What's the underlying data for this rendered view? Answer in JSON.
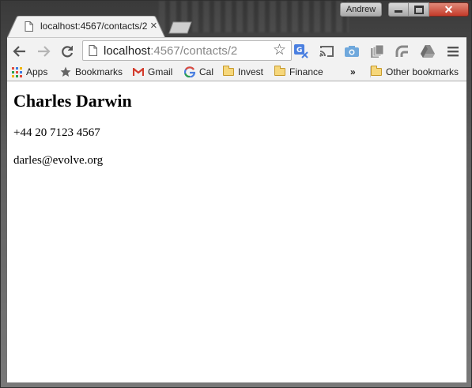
{
  "window": {
    "profile_name": "Andrew",
    "close_glyph": "✕"
  },
  "tab": {
    "title": "localhost:4567/contacts/2",
    "close_glyph": "×"
  },
  "toolbar": {
    "url_host": "localhost",
    "url_path": ":4567/contacts/2",
    "star_glyph": "☆"
  },
  "bookmarks": {
    "items": [
      {
        "label": "Apps",
        "icon": "apps-grid-icon"
      },
      {
        "label": "Bookmarks",
        "icon": "star-icon"
      },
      {
        "label": "Gmail",
        "icon": "gmail-icon"
      },
      {
        "label": "Cal",
        "icon": "google-icon"
      },
      {
        "label": "Invest",
        "icon": "folder-icon"
      },
      {
        "label": "Finance",
        "icon": "folder-icon"
      }
    ],
    "overflow": "»",
    "other": "Other bookmarks"
  },
  "page": {
    "name": "Charles Darwin",
    "phone": "+44 20 7123 4567",
    "email": "darles@evolve.org"
  }
}
